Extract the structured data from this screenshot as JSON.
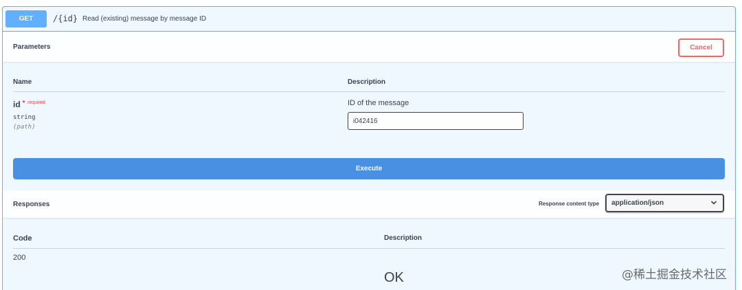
{
  "operation": {
    "method": "GET",
    "path": "/{id}",
    "description": "Read (existing) message by message ID"
  },
  "parameters": {
    "title": "Parameters",
    "cancel_label": "Cancel",
    "col_name": "Name",
    "col_description": "Description",
    "items": [
      {
        "name": "id",
        "required_star": "*",
        "required_label": "required",
        "type": "string",
        "in": "(path)",
        "description": "ID of the message",
        "value": "i042416"
      }
    ]
  },
  "execute_label": "Execute",
  "responses": {
    "title": "Responses",
    "content_type_label": "Response content type",
    "content_type_value": "application/json",
    "col_code": "Code",
    "col_description": "Description",
    "rows": [
      {
        "code": "200",
        "description": "OK"
      }
    ]
  },
  "watermark": "@稀土掘金技术社区",
  "colors": {
    "get_accent": "#61affe",
    "execute": "#4990e2",
    "cancel": "#ff6060",
    "required": "#f93e3e"
  }
}
